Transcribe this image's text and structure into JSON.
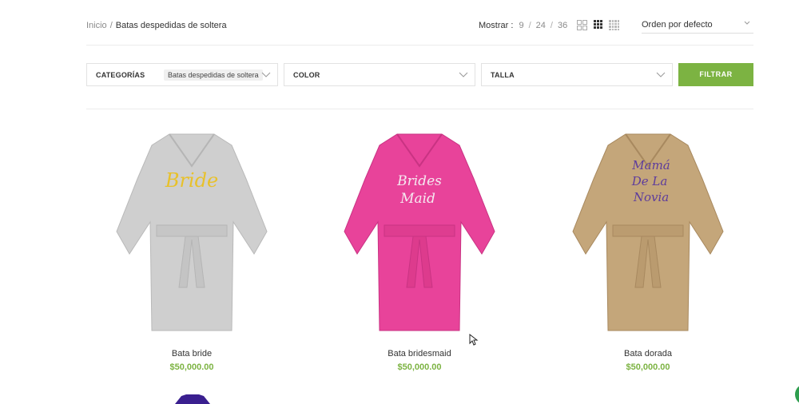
{
  "breadcrumb": {
    "home": "Inicio",
    "separator": "/",
    "current": "Batas despedidas de soltera"
  },
  "show": {
    "label": "Mostrar :",
    "options": [
      "9",
      "24",
      "36"
    ]
  },
  "view_icons": [
    "grid-2-icon",
    "grid-3-icon",
    "grid-4-icon"
  ],
  "sort": {
    "selected": "Orden por defecto"
  },
  "filters": {
    "categories": {
      "label": "CATEGORÍAS",
      "selected": "Batas despedidas de soltera"
    },
    "color": {
      "label": "COLOR"
    },
    "size": {
      "label": "TALLA"
    },
    "button": "FILTRAR"
  },
  "products": [
    {
      "name": "Bata bride",
      "price": "$50,000.00",
      "embroidery": "Bride",
      "robe_color": "#cfcfcf",
      "text_color": "#e8c12a"
    },
    {
      "name": "Bata bridesmaid",
      "price": "$50,000.00",
      "embroidery_lines": [
        "Brides",
        "Maid"
      ],
      "robe_color": "#e8439a",
      "text_color": "#f5e9f0"
    },
    {
      "name": "Bata dorada",
      "price": "$50,000.00",
      "embroidery_lines": [
        "Mamá",
        "De La",
        "Novia"
      ],
      "robe_color": "#c4a67a",
      "text_color": "#5d3c9c"
    }
  ],
  "colors": {
    "accent": "#7cb342",
    "price": "#7cb342"
  }
}
